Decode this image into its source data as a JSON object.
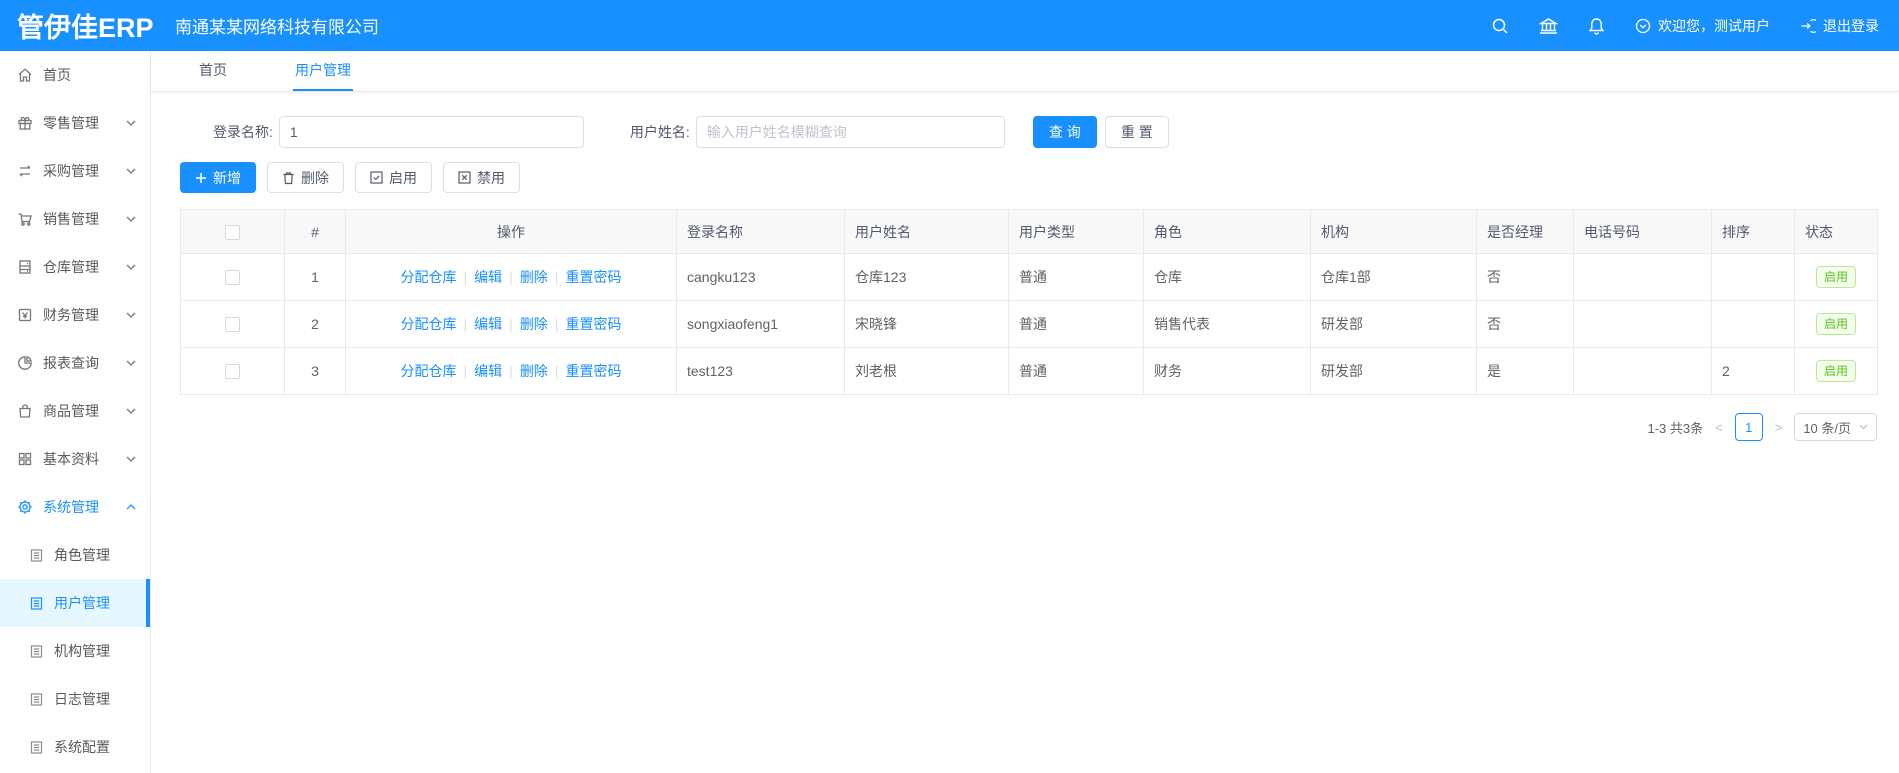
{
  "header": {
    "logo": "管伊佳ERP",
    "company": "南通某某网络科技有限公司",
    "welcome": "欢迎您，测试用户",
    "logout": "退出登录"
  },
  "colors": {
    "primary": "#1890ff",
    "status_enabled": "#52c41a",
    "active_menu_bg": "#e7f7ff"
  },
  "sidebar": {
    "items": [
      {
        "label": "首页"
      },
      {
        "label": "零售管理"
      },
      {
        "label": "采购管理"
      },
      {
        "label": "销售管理"
      },
      {
        "label": "仓库管理"
      },
      {
        "label": "财务管理"
      },
      {
        "label": "报表查询"
      },
      {
        "label": "商品管理"
      },
      {
        "label": "基本资料"
      },
      {
        "label": "系统管理",
        "children": [
          {
            "label": "角色管理"
          },
          {
            "label": "用户管理"
          },
          {
            "label": "机构管理"
          },
          {
            "label": "日志管理"
          },
          {
            "label": "系统配置"
          }
        ]
      }
    ]
  },
  "tabs": [
    {
      "label": "首页"
    },
    {
      "label": "用户管理"
    }
  ],
  "search": {
    "login_label": "登录名称:",
    "login_value": "1",
    "name_label": "用户姓名:",
    "name_placeholder": "输入用户姓名模糊查询",
    "query_label": "查 询",
    "reset_label": "重 置"
  },
  "toolbar": {
    "add_label": "新增",
    "delete_label": "删除",
    "enable_label": "启用",
    "disable_label": "禁用"
  },
  "table": {
    "headers": [
      "#",
      "操作",
      "登录名称",
      "用户姓名",
      "用户类型",
      "角色",
      "机构",
      "是否经理",
      "电话号码",
      "排序",
      "状态"
    ],
    "actions": [
      "分配仓库",
      "编辑",
      "删除",
      "重置密码"
    ],
    "rows": [
      {
        "index": "1",
        "login": "cangku123",
        "name": "仓库123",
        "type": "普通",
        "role": "仓库",
        "org": "仓库1部",
        "manager": "否",
        "phone": "",
        "sort": "",
        "status": "启用"
      },
      {
        "index": "2",
        "login": "songxiaofeng1",
        "name": "宋晓锋",
        "type": "普通",
        "role": "销售代表",
        "org": "研发部",
        "manager": "否",
        "phone": "",
        "sort": "",
        "status": "启用"
      },
      {
        "index": "3",
        "login": "test123",
        "name": "刘老根",
        "type": "普通",
        "role": "财务",
        "org": "研发部",
        "manager": "是",
        "phone": "",
        "sort": "2",
        "status": "启用"
      }
    ]
  },
  "pagination": {
    "total_text": "1-3 共3条",
    "prev": "<",
    "page": "1",
    "next": ">",
    "page_size": "10 条/页"
  }
}
